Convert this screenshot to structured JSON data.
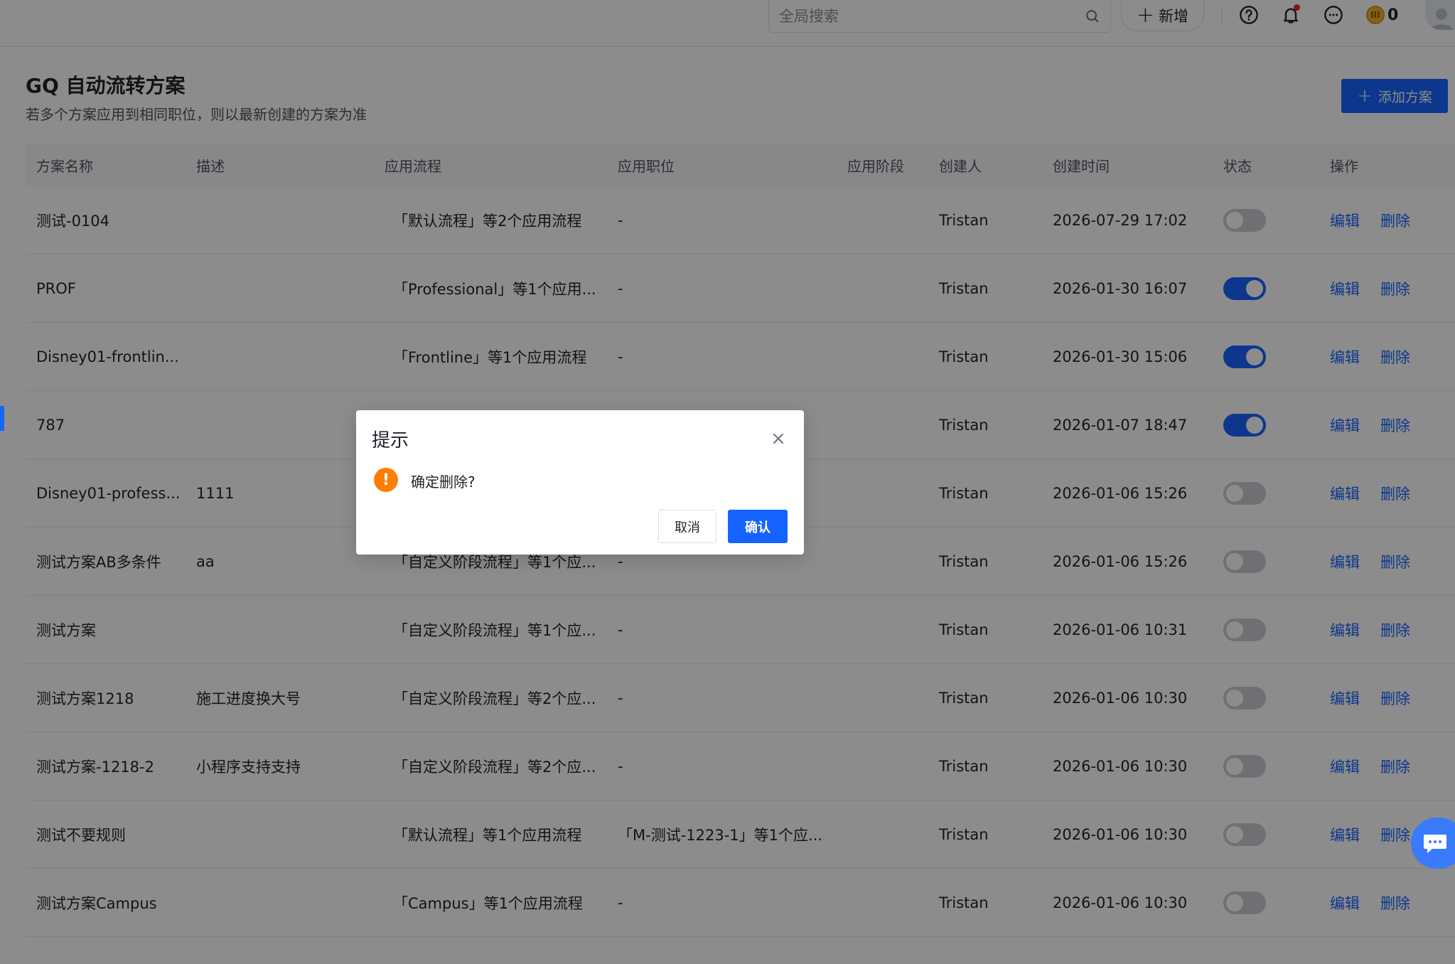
{
  "topbar": {
    "search_placeholder": "全局搜索",
    "new_label": "新增",
    "coin_count": "0"
  },
  "page": {
    "title": "GQ 自动流转方案",
    "subtitle": "若多个方案应用到相同职位，则以最新创建的方案为准",
    "add_button_label": "添加方案"
  },
  "table": {
    "columns": [
      "方案名称",
      "描述",
      "应用流程",
      "应用职位",
      "应用阶段",
      "创建人",
      "创建时间",
      "状态",
      "操作"
    ],
    "edit_label": "编辑",
    "delete_label": "删除",
    "rows": [
      {
        "name": "测试-0104",
        "desc": "",
        "flow": "「默认流程」等2个应用流程",
        "position": "-",
        "stage": "",
        "creator": "Tristan",
        "time": "2026-07-29 17:02",
        "enabled": false
      },
      {
        "name": "PROF",
        "desc": "",
        "flow": "「Professional」等1个应用...",
        "position": "-",
        "stage": "",
        "creator": "Tristan",
        "time": "2026-01-30 16:07",
        "enabled": true
      },
      {
        "name": "Disney01-frontlin...",
        "desc": "",
        "flow": "「Frontline」等1个应用流程",
        "position": "-",
        "stage": "",
        "creator": "Tristan",
        "time": "2026-01-30 15:06",
        "enabled": true
      },
      {
        "name": "787",
        "desc": "",
        "flow": "",
        "position": "",
        "stage": "",
        "creator": "Tristan",
        "time": "2026-01-07 18:47",
        "enabled": true
      },
      {
        "name": "Disney01-profess...",
        "desc": "1111",
        "flow": "",
        "position": "",
        "stage": "",
        "creator": "Tristan",
        "time": "2026-01-06 15:26",
        "enabled": false
      },
      {
        "name": "测试方案AB多条件",
        "desc": "aa",
        "flow": "「自定义阶段流程」等1个应...",
        "position": "-",
        "stage": "",
        "creator": "Tristan",
        "time": "2026-01-06 15:26",
        "enabled": false
      },
      {
        "name": "测试方案",
        "desc": "",
        "flow": "「自定义阶段流程」等1个应...",
        "position": "-",
        "stage": "",
        "creator": "Tristan",
        "time": "2026-01-06 10:31",
        "enabled": false
      },
      {
        "name": "测试方案1218",
        "desc": "施工进度换大号",
        "flow": "「自定义阶段流程」等2个应...",
        "position": "-",
        "stage": "",
        "creator": "Tristan",
        "time": "2026-01-06 10:30",
        "enabled": false
      },
      {
        "name": "测试方案-1218-2",
        "desc": "小程序支持支持",
        "flow": "「自定义阶段流程」等2个应...",
        "position": "-",
        "stage": "",
        "creator": "Tristan",
        "time": "2026-01-06 10:30",
        "enabled": false
      },
      {
        "name": "测试不要规则",
        "desc": "",
        "flow": "「默认流程」等1个应用流程",
        "position": "「M-测试-1223-1」等1个应...",
        "stage": "",
        "creator": "Tristan",
        "time": "2026-01-06 10:30",
        "enabled": false
      },
      {
        "name": "测试方案Campus",
        "desc": "",
        "flow": "「Campus」等1个应用流程",
        "position": "-",
        "stage": "",
        "creator": "Tristan",
        "time": "2026-01-06 10:30",
        "enabled": false
      }
    ]
  },
  "dialog": {
    "title": "提示",
    "message": "确定删除?",
    "cancel_label": "取消",
    "confirm_label": "确认"
  },
  "colors": {
    "primary": "#1664ff",
    "warning": "#ff7d00",
    "mask": "rgba(0,0,0,0.45)"
  }
}
